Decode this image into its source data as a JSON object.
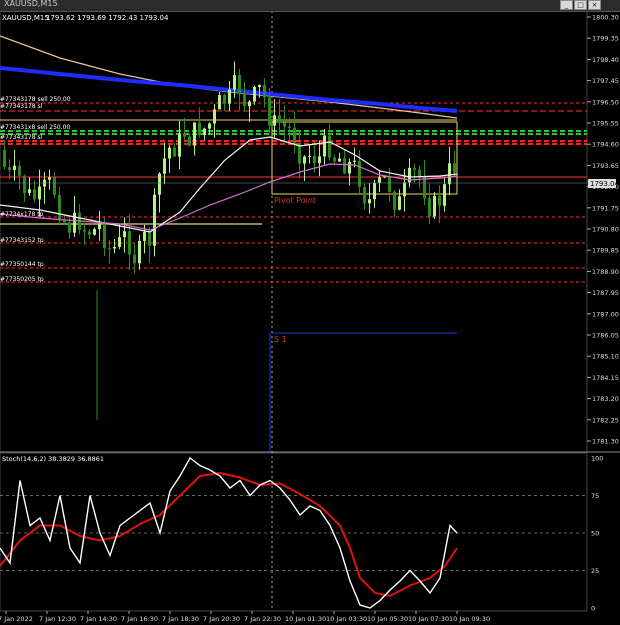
{
  "window": {
    "title": "XAUUSD,M15",
    "buttons": [
      "_",
      "□",
      "×"
    ]
  },
  "header": {
    "symbol": "XAUUSD,M15",
    "ohlc": "1793.62 1793.69 1792.43 1793.04"
  },
  "price_axis": {
    "labels": [
      "1800.30",
      "1799.35",
      "1798.40",
      "1797.45",
      "1796.50",
      "1795.55",
      "1794.60",
      "1793.65",
      "1792.70",
      "1791.75",
      "1790.80",
      "1789.85",
      "1788.90",
      "1787.95",
      "1787.00",
      "1786.05",
      "1785.10",
      "1784.15",
      "1783.20",
      "1782.25",
      "1781.30"
    ],
    "current_price": "1793.04"
  },
  "time_axis": {
    "labels": [
      "7 Jan 2022",
      "7 Jan 12:30",
      "7 Jan 14:30",
      "7 Jan 16:30",
      "7 Jan 18:30",
      "7 Jan 20:30",
      "7 Jan 22:30",
      "10 Jan 01:30",
      "10 Jan 03:30",
      "10 Jan 05:30",
      "10 Jan 07:30",
      "10 Jan 09:30"
    ]
  },
  "order_labels": [
    "#77343178 sell 250.00",
    "#77343178 sl",
    "#773431x8 sell 250.00",
    "#77343178 sl",
    "#7734x178 tp",
    "#77343152 tp",
    "#77350144 tp",
    "#77350205 tp"
  ],
  "annotations": {
    "pivot": "Pivot Point",
    "s1": "S 1"
  },
  "indicator": {
    "label": "Stoch(14,6,2) 38.3829 36.8861",
    "levels": [
      "100",
      "75",
      "50",
      "25",
      "0"
    ]
  },
  "colors": {
    "background": "#000000",
    "bull_candle": "#b6f08a",
    "bear_candle": "#2f8a1e",
    "ma_blue": "#1f2cff",
    "ma_tan": "#e8c89a",
    "ma_white": "#f5f5f5",
    "ma_pink": "#d070d0",
    "stoch_main": "#ffffff",
    "stoch_signal": "#e01010",
    "level_line": "#ff2020"
  }
}
